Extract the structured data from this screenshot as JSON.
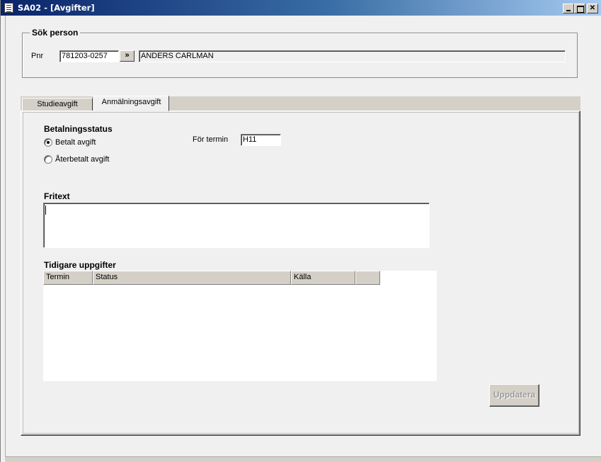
{
  "window": {
    "title": "SA02 - [Avgifter]",
    "icons": [
      "document-icon",
      "minimize-icon",
      "maximize-icon",
      "close-icon"
    ]
  },
  "search": {
    "legend": "Sök person",
    "pnr_label": "Pnr",
    "pnr_value": "781203-0257",
    "go_label": "»",
    "name_value": "ANDERS CARLMAN"
  },
  "tabs": [
    {
      "label": "Studieavgift",
      "active": false
    },
    {
      "label": "Anmälningsavgift",
      "active": true
    }
  ],
  "payment": {
    "heading": "Betalningsstatus",
    "options": [
      {
        "label": "Betalt avgift",
        "selected": true
      },
      {
        "label": "Återbetalt avgift",
        "selected": false
      }
    ],
    "term_label": "För termin",
    "term_value": "H11"
  },
  "fritext": {
    "heading": "Fritext",
    "value": ""
  },
  "history": {
    "heading": "Tidigare uppgifter",
    "columns": [
      "Termin",
      "Status",
      "Källa",
      ""
    ],
    "rows": []
  },
  "actions": {
    "update_label": "Uppdatera",
    "update_enabled": false
  }
}
